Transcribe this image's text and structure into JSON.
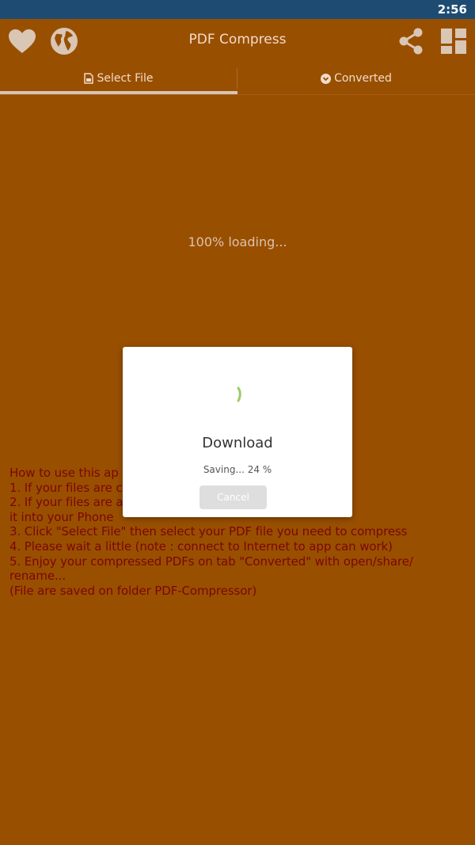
{
  "status_bar": {
    "time": "2:56"
  },
  "app_bar": {
    "title": "PDF Compress",
    "icons": [
      "heart-icon",
      "globe-icon",
      "share-icon",
      "grid-icon"
    ]
  },
  "tabs": [
    {
      "label": "Select File",
      "icon": "file-icon",
      "selected": true
    },
    {
      "label": "Converted",
      "icon": "check-circle-icon",
      "selected": false
    }
  ],
  "main": {
    "loading_text": "100% loading...",
    "instructions": [
      "How to use this ap",
      "1. If your files are                                                  ct File\"",
      "2. If your files are                                                ager app to copy",
      "it into your Phone",
      "3. Click \"Select File\" then select your PDF file you need to compress",
      "4. Please wait a little (note : connect to Internet to app can work)",
      "5. Enjoy your compressed PDFs on tab \"Converted\" with open/share/",
      "rename...",
      "(File are saved on folder PDF-Compressor)"
    ]
  },
  "dialog": {
    "title": "Download",
    "message": "Saving... 24 %",
    "cancel_label": "Cancel"
  },
  "colors": {
    "background": "#994f00",
    "status_bar": "#1e4b72",
    "instruction_text": "#7a0707",
    "spinner": "#8bc34a"
  }
}
